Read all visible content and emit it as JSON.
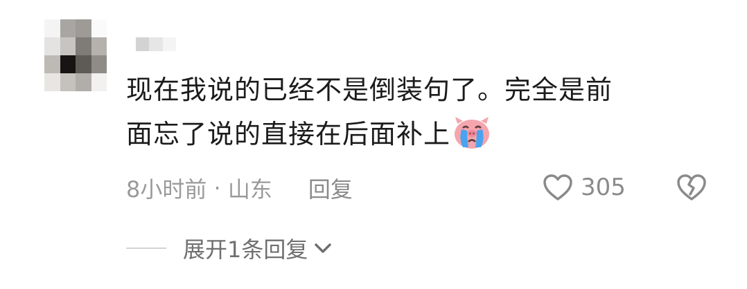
{
  "comment": {
    "text_line1": "现在我说的已经不是倒装句了。完全是前",
    "text_line2": "面忘了说的直接在后面补上",
    "emoji": "crying-pig-emoji",
    "time": "8小时前",
    "separator": " · ",
    "location": "山东",
    "reply_label": "回复",
    "like_count": "305"
  },
  "expand": {
    "label": "展开1条回复"
  },
  "icons": {
    "like": "heart-outline-icon",
    "dislike": "broken-heart-icon",
    "expand": "chevron-down-icon"
  },
  "colors": {
    "text": "#1b1b1b",
    "meta": "#9a9a9a",
    "icon": "#8a8a8a",
    "pig": "#f4a5ad",
    "tears": "#4aa3f0"
  }
}
